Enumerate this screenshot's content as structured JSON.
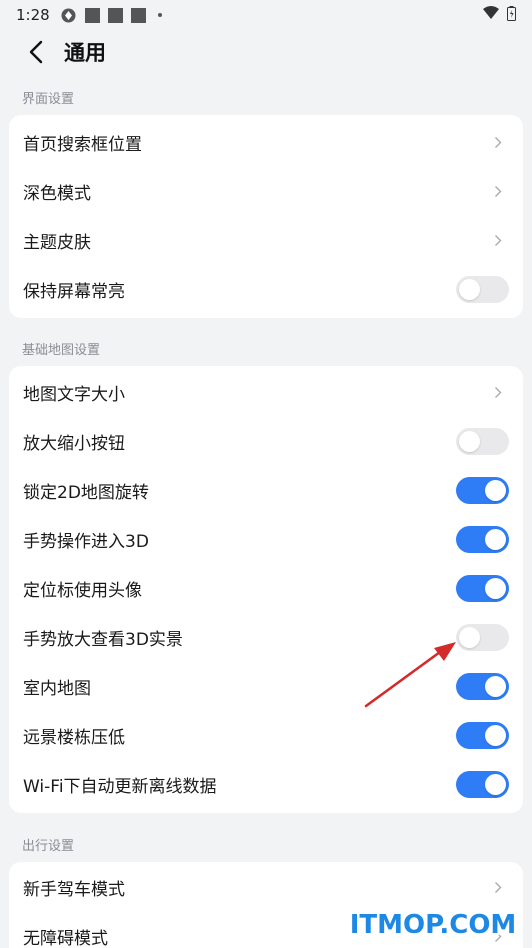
{
  "status_bar": {
    "time": "1:28"
  },
  "header": {
    "title": "通用"
  },
  "sections": [
    {
      "title": "界面设置",
      "rows": [
        {
          "label": "首页搜索框位置",
          "control": "chevron"
        },
        {
          "label": "深色模式",
          "control": "chevron"
        },
        {
          "label": "主题皮肤",
          "control": "chevron"
        },
        {
          "label": "保持屏幕常亮",
          "control": "toggle",
          "on": false
        }
      ]
    },
    {
      "title": "基础地图设置",
      "rows": [
        {
          "label": "地图文字大小",
          "control": "chevron"
        },
        {
          "label": "放大缩小按钮",
          "control": "toggle",
          "on": false
        },
        {
          "label": "锁定2D地图旋转",
          "control": "toggle",
          "on": true
        },
        {
          "label": "手势操作进入3D",
          "control": "toggle",
          "on": true
        },
        {
          "label": "定位标使用头像",
          "control": "toggle",
          "on": true
        },
        {
          "label": "手势放大查看3D实景",
          "control": "toggle",
          "on": false
        },
        {
          "label": "室内地图",
          "control": "toggle",
          "on": true
        },
        {
          "label": "远景楼栋压低",
          "control": "toggle",
          "on": true
        },
        {
          "label": "Wi-Fi下自动更新离线数据",
          "control": "toggle",
          "on": true
        }
      ]
    },
    {
      "title": "出行设置",
      "rows": [
        {
          "label": "新手驾车模式",
          "control": "chevron"
        },
        {
          "label": "无障碍模式",
          "control": "chevron"
        }
      ]
    }
  ],
  "colors": {
    "accent": "#2f7df6",
    "toggle_off": "#e9e9eb",
    "background": "#f1f3f5",
    "annotation_arrow": "#d42a2a"
  },
  "watermark": {
    "text": "ITMOP.COM"
  }
}
